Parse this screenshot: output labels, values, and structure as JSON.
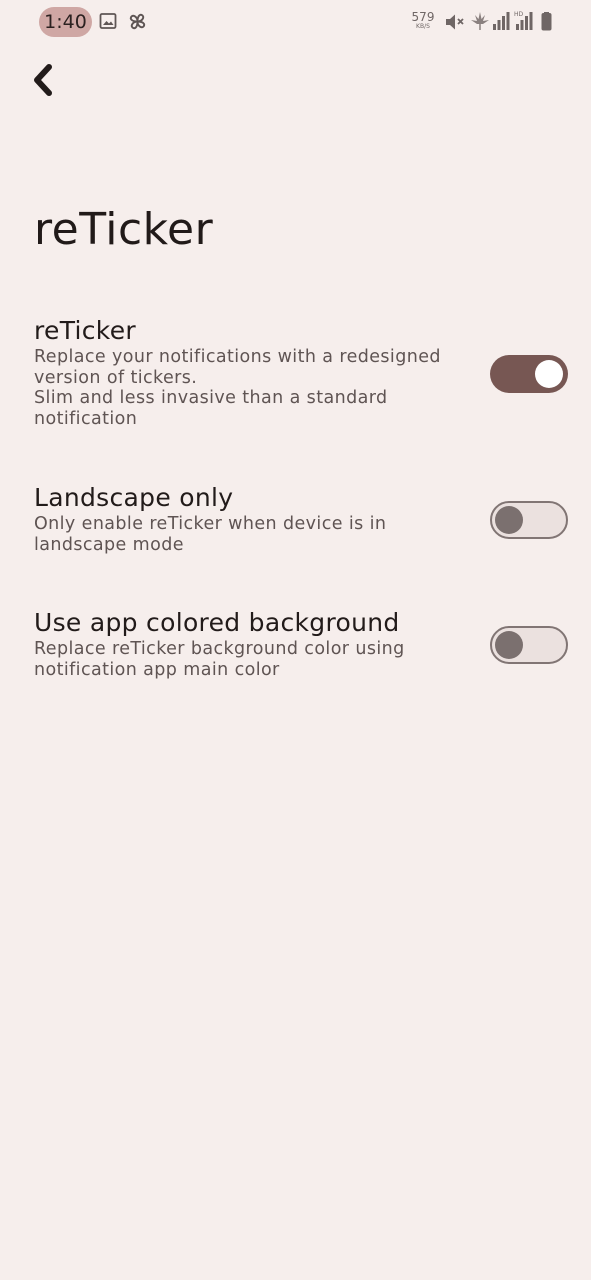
{
  "status_bar": {
    "time": "1:40",
    "net_speed_value": "579",
    "net_speed_unit": "KB/S",
    "icons": [
      "image-icon",
      "pinwheel-icon",
      "mute-icon",
      "leaf-icon",
      "signal-icon",
      "hd-signal-icon",
      "battery-icon"
    ]
  },
  "header": {
    "back_icon": "back-arrow-icon",
    "title": "reTicker"
  },
  "settings": [
    {
      "title": "reTicker",
      "description": "Replace your notifications with a redesigned\nversion of tickers.\nSlim and less invasive than a standard\nnotification",
      "enabled": true
    },
    {
      "title": "Landscape only",
      "description": "Only enable reTicker when device is in\nlandscape mode",
      "enabled": false
    },
    {
      "title": "Use app colored background",
      "description": "Replace reTicker background color using\nnotification app main color",
      "enabled": false
    }
  ],
  "colors": {
    "background": "#f6eeec",
    "accent": "#775753",
    "time_pill": "#cfa7a4",
    "text_primary": "#221b1a",
    "text_secondary": "#5f5453"
  }
}
